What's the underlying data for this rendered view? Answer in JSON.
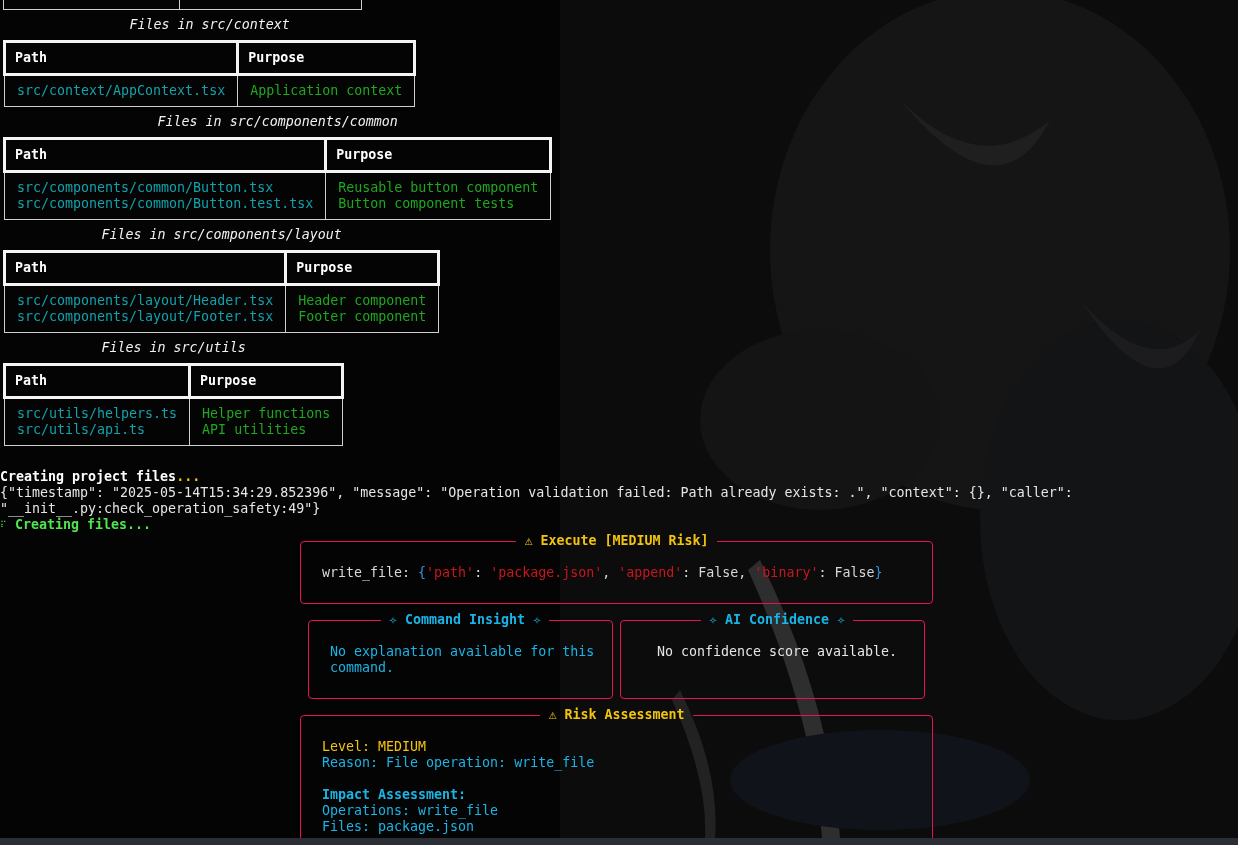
{
  "file_tables": [
    {
      "caption": "Files in src/context",
      "columns": [
        "Path",
        "Purpose"
      ],
      "rows": [
        [
          "src/context/AppContext.tsx",
          "Application context"
        ]
      ]
    },
    {
      "caption": "Files in src/components/common",
      "columns": [
        "Path",
        "Purpose"
      ],
      "rows": [
        [
          "src/components/common/Button.tsx",
          "Reusable button component"
        ],
        [
          "src/components/common/Button.test.tsx",
          "Button component tests"
        ]
      ]
    },
    {
      "caption": "Files in src/components/layout",
      "columns": [
        "Path",
        "Purpose"
      ],
      "rows": [
        [
          "src/components/layout/Header.tsx",
          "Header component"
        ],
        [
          "src/components/layout/Footer.tsx",
          "Footer component"
        ]
      ]
    },
    {
      "caption": "Files in src/utils",
      "columns": [
        "Path",
        "Purpose"
      ],
      "rows": [
        [
          "src/utils/helpers.ts",
          "Helper functions"
        ],
        [
          "src/utils/api.ts",
          "API utilities"
        ]
      ]
    }
  ],
  "status_line": {
    "parts": [
      {
        "kind": "label",
        "text": "Creating project files"
      },
      {
        "kind": "ellipsis",
        "text": "..."
      }
    ]
  },
  "log_lines": [
    "{\"timestamp\": \"2025-05-14T15:34:29.852396\", \"message\": \"Operation validation failed: Path already exists: .\", \"context\": {}, \"caller\":",
    "\"__init__.py:check_operation_safety:49\"}"
  ],
  "progress_line": {
    "spinner": "⠏",
    "text": "Creating files..."
  },
  "execute_panel": {
    "title": "⚠ Execute [MEDIUM Risk]",
    "code_tokens": [
      {
        "kind": "plain",
        "text": "write_file: "
      },
      {
        "kind": "brace",
        "text": "{"
      },
      {
        "kind": "string",
        "text": "'path'"
      },
      {
        "kind": "plain",
        "text": ": "
      },
      {
        "kind": "string",
        "text": "'package.json'"
      },
      {
        "kind": "plain",
        "text": ", "
      },
      {
        "kind": "string",
        "text": "'append'"
      },
      {
        "kind": "plain",
        "text": ": False, "
      },
      {
        "kind": "string",
        "text": "'binary'"
      },
      {
        "kind": "plain",
        "text": ": False"
      },
      {
        "kind": "brace",
        "text": "}"
      }
    ]
  },
  "insight_panels": [
    {
      "kind": "explanation",
      "title": "✧ Command Insight ✧",
      "text": "No explanation available for this command."
    },
    {
      "kind": "score",
      "title": "✧ AI Confidence ✧",
      "text": "No confidence score available."
    }
  ],
  "risk_panel": {
    "title": "⚠ Risk Assessment",
    "lines": [
      {
        "kind": "level",
        "text": "Level: MEDIUM"
      },
      {
        "kind": "info",
        "text": "Reason: File operation: write_file"
      },
      {
        "kind": "heading",
        "text": "Impact Assessment:"
      },
      {
        "kind": "info",
        "text": "Operations: write_file"
      },
      {
        "kind": "info",
        "text": "Files: package.json"
      }
    ]
  }
}
